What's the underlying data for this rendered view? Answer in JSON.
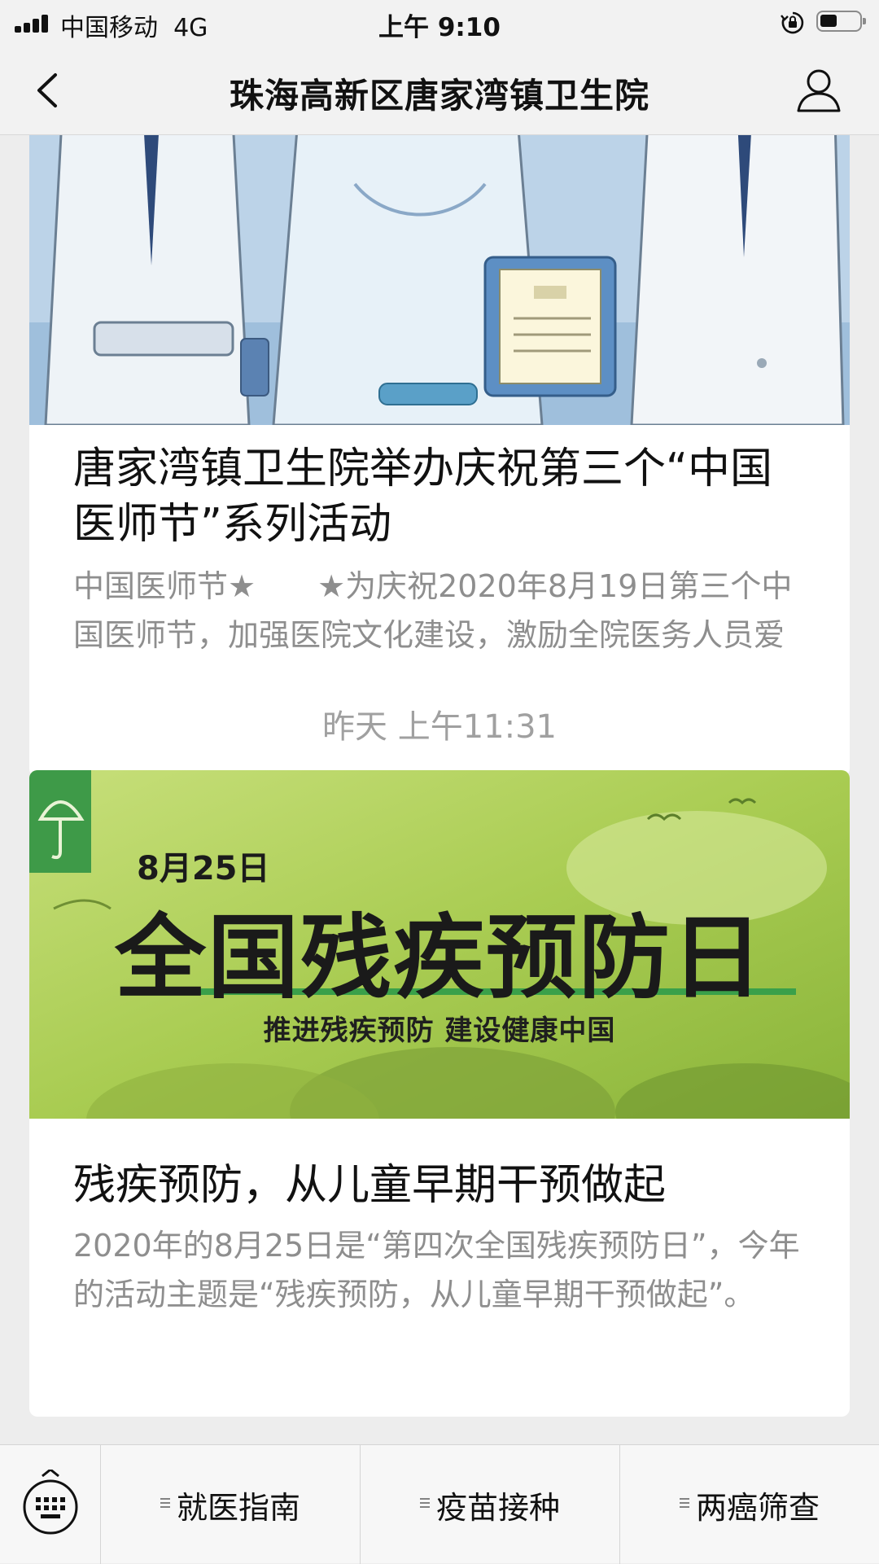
{
  "status_bar": {
    "carrier": "中国移动",
    "network": "4G",
    "time": "上午 9:10",
    "battery_level": 0.45
  },
  "nav": {
    "title": "珠海高新区唐家湾镇卫生院"
  },
  "articles": [
    {
      "title": "唐家湾镇卫生院举办庆祝第三个“中国医师节”系列活动",
      "description": "中国医师节★　　★为庆祝2020年8月19日第三个中国医师节，加强医院文化建设，激励全院医务人员爱",
      "cover_icon": "doctors-illustration-image"
    },
    {
      "title": "残疾预防，从儿童早期干预做起",
      "description": "2020年的8月25日是“第四次全国残疾预防日”，今年的活动主题是“残疾预防，从儿童早期干预做起”。",
      "banner": {
        "date": "8月25日",
        "title": "全国残疾预防日",
        "subtitle": "推进残疾预防 建设健康中国"
      }
    }
  ],
  "timestamp": "昨天 上午11:31",
  "bottom_menu": {
    "items": [
      "就医指南",
      "疫苗接种",
      "两癌筛查"
    ]
  },
  "colors": {
    "background": "#ededed",
    "card": "#ffffff",
    "muted_text": "#8e8e8e",
    "banner_green": "#9cc24a"
  }
}
